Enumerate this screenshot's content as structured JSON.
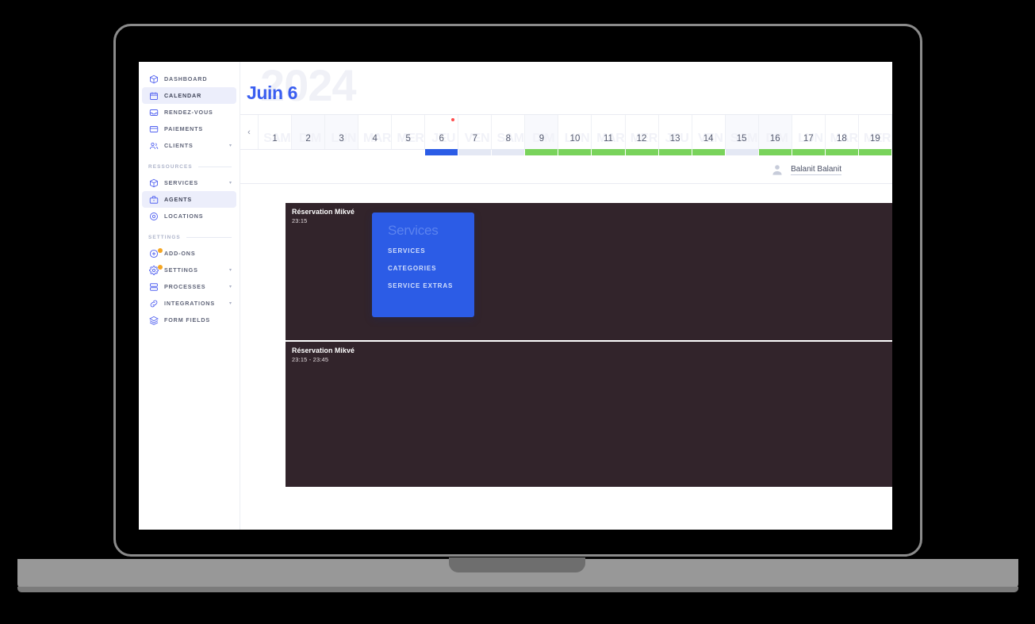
{
  "sidebar": {
    "primary_items": [
      {
        "label": "DASHBOARD",
        "icon": "cube-icon",
        "active": false,
        "caret": false,
        "badge": false
      },
      {
        "label": "CALENDAR",
        "icon": "calendar-icon",
        "active": true,
        "caret": false,
        "badge": false
      },
      {
        "label": "RENDEZ-VOUS",
        "icon": "inbox-icon",
        "active": false,
        "caret": false,
        "badge": false
      },
      {
        "label": "PAIEMENTS",
        "icon": "card-icon",
        "active": false,
        "caret": false,
        "badge": false
      },
      {
        "label": "CLIENTS",
        "icon": "users-icon",
        "active": false,
        "caret": true,
        "badge": false
      }
    ],
    "ressources_label": "RESSOURCES",
    "ressources_items": [
      {
        "label": "SERVICES",
        "icon": "cube-icon",
        "active": false,
        "caret": true,
        "badge": false
      },
      {
        "label": "AGENTS",
        "icon": "briefcase-icon",
        "active": true,
        "caret": false,
        "badge": false
      },
      {
        "label": "LOCATIONS",
        "icon": "pin-icon",
        "active": false,
        "caret": false,
        "badge": false
      }
    ],
    "settings_label": "SETTINGS",
    "settings_items": [
      {
        "label": "ADD-ONS",
        "icon": "plus-circle-icon",
        "active": false,
        "caret": false,
        "badge": true
      },
      {
        "label": "SETTINGS",
        "icon": "gear-icon",
        "active": false,
        "caret": true,
        "badge": true
      },
      {
        "label": "PROCESSES",
        "icon": "stack-icon",
        "active": false,
        "caret": true,
        "badge": false
      },
      {
        "label": "INTEGRATIONS",
        "icon": "link-icon",
        "active": false,
        "caret": true,
        "badge": false
      },
      {
        "label": "FORM FIELDS",
        "icon": "layers-icon",
        "active": false,
        "caret": false,
        "badge": false
      }
    ]
  },
  "popup": {
    "title": "Services",
    "links": [
      {
        "label": "SERVICES"
      },
      {
        "label": "CATEGORIES"
      },
      {
        "label": "SERVICE EXTRAS"
      }
    ]
  },
  "calendar": {
    "year_ghost": "2024",
    "month_title": "Juin 6",
    "prev_arrow": "‹",
    "days": [
      {
        "num": "1",
        "name": "SAM",
        "tinted": false,
        "reddot": false,
        "bar": "none"
      },
      {
        "num": "2",
        "name": "DIM",
        "tinted": true,
        "reddot": false,
        "bar": "none"
      },
      {
        "num": "3",
        "name": "LUN",
        "tinted": true,
        "reddot": false,
        "bar": "none"
      },
      {
        "num": "4",
        "name": "MAR",
        "tinted": false,
        "reddot": false,
        "bar": "none"
      },
      {
        "num": "5",
        "name": "MER",
        "tinted": false,
        "reddot": false,
        "bar": "none"
      },
      {
        "num": "6",
        "name": "JEU",
        "tinted": false,
        "reddot": true,
        "bar": "blue"
      },
      {
        "num": "7",
        "name": "VEN",
        "tinted": false,
        "reddot": false,
        "bar": "grey"
      },
      {
        "num": "8",
        "name": "SAM",
        "tinted": false,
        "reddot": false,
        "bar": "grey"
      },
      {
        "num": "9",
        "name": "DIM",
        "tinted": true,
        "reddot": false,
        "bar": "green"
      },
      {
        "num": "10",
        "name": "LUN",
        "tinted": false,
        "reddot": false,
        "bar": "green"
      },
      {
        "num": "11",
        "name": "MAR",
        "tinted": false,
        "reddot": false,
        "bar": "green"
      },
      {
        "num": "12",
        "name": "MER",
        "tinted": false,
        "reddot": false,
        "bar": "green"
      },
      {
        "num": "13",
        "name": "JEU",
        "tinted": false,
        "reddot": false,
        "bar": "green"
      },
      {
        "num": "14",
        "name": "VEN",
        "tinted": false,
        "reddot": false,
        "bar": "green"
      },
      {
        "num": "15",
        "name": "SAM",
        "tinted": true,
        "reddot": false,
        "bar": "grey"
      },
      {
        "num": "16",
        "name": "DIM",
        "tinted": true,
        "reddot": false,
        "bar": "green"
      },
      {
        "num": "17",
        "name": "LUN",
        "tinted": false,
        "reddot": false,
        "bar": "green"
      },
      {
        "num": "18",
        "name": "MAR",
        "tinted": false,
        "reddot": false,
        "bar": "green"
      },
      {
        "num": "19",
        "name": "MER",
        "tinted": false,
        "reddot": false,
        "bar": "green"
      }
    ],
    "agent": {
      "name": "Balanit Balanit"
    },
    "events": [
      {
        "title": "Réservation Mikvé",
        "time": "23:15"
      },
      {
        "title": "Réservation Mikvé",
        "time": "23:15 - 23:45"
      }
    ]
  },
  "colors": {
    "accent_blue": "#2c5ce6",
    "title_blue": "#3a5ef0",
    "event_dark": "#32242b",
    "available_green": "#79d35b",
    "badge_orange": "#f5a623",
    "today_red": "#ff4d4d"
  }
}
